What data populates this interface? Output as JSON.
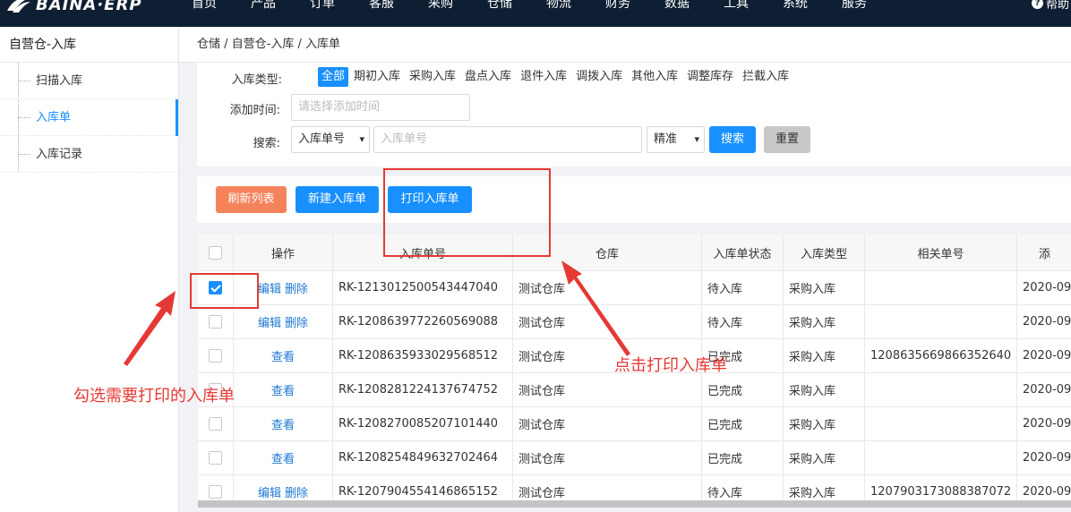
{
  "topbar": {
    "logo_text": "BAINA·ERP",
    "nav": [
      "首页",
      "产品",
      "订单",
      "客服",
      "采购",
      "仓储",
      "物流",
      "财务",
      "数据",
      "工具",
      "系统",
      "服务"
    ],
    "help_label": "帮助"
  },
  "sidebar": {
    "title": "自营仓-入库",
    "items": [
      {
        "label": "扫描入库"
      },
      {
        "label": "入库单"
      },
      {
        "label": "入库记录"
      }
    ]
  },
  "breadcrumb": "仓储 / 自营仓-入库 / 入库单",
  "filters": {
    "type_label": "入库类型:",
    "types": [
      "全部",
      "期初入库",
      "采购入库",
      "盘点入库",
      "退件入库",
      "调拨入库",
      "其他入库",
      "调整库存",
      "拦截入库"
    ],
    "selected_type": "全部",
    "time_label": "添加时间:",
    "time_placeholder": "请选择添加时间",
    "search_label": "搜索:",
    "search_field": "入库单号",
    "search_placeholder": "入库单号",
    "match_mode": "精准",
    "search_button": "搜索",
    "reset_button": "重置"
  },
  "toolbar": {
    "refresh": "刷新列表",
    "create": "新建入库单",
    "print": "打印入库单"
  },
  "table": {
    "headers": [
      "操作",
      "入库单号",
      "仓库",
      "入库单状态",
      "入库类型",
      "相关单号",
      "添"
    ],
    "rows": [
      {
        "checked": true,
        "actions": [
          "编辑",
          "删除"
        ],
        "no": "RK-1213012500543447040",
        "warehouse": "测试仓库",
        "status": "待入库",
        "type": "采购入库",
        "related": "",
        "date": "2020-09"
      },
      {
        "checked": false,
        "actions": [
          "编辑",
          "删除"
        ],
        "no": "RK-1208639772260569088",
        "warehouse": "测试仓库",
        "status": "待入库",
        "type": "采购入库",
        "related": "",
        "date": "2020-09"
      },
      {
        "checked": false,
        "actions": [
          "查看"
        ],
        "no": "RK-1208635933029568512",
        "warehouse": "测试仓库",
        "status": "已完成",
        "type": "采购入库",
        "related": "1208635669866352640",
        "date": "2020-09"
      },
      {
        "checked": false,
        "actions": [
          "查看"
        ],
        "no": "RK-1208281224137674752",
        "warehouse": "测试仓库",
        "status": "已完成",
        "type": "采购入库",
        "related": "",
        "date": "2020-09"
      },
      {
        "checked": false,
        "actions": [
          "查看"
        ],
        "no": "RK-1208270085207101440",
        "warehouse": "测试仓库",
        "status": "已完成",
        "type": "采购入库",
        "related": "",
        "date": "2020-09"
      },
      {
        "checked": false,
        "actions": [
          "查看"
        ],
        "no": "RK-1208254849632702464",
        "warehouse": "测试仓库",
        "status": "已完成",
        "type": "采购入库",
        "related": "",
        "date": "2020-09"
      },
      {
        "checked": false,
        "actions": [
          "编辑",
          "删除"
        ],
        "no": "RK-1207904554146865152",
        "warehouse": "测试仓库",
        "status": "待入库",
        "type": "采购入库",
        "related": "1207903173088387072",
        "date": "2020-09"
      }
    ]
  },
  "annotations": {
    "click_print": "点击打印入库单",
    "select_rows": "勾选需要打印的入库单"
  },
  "colors": {
    "primary": "#1890ff",
    "topbar": "#0f1f33",
    "annotation": "#e53935",
    "refresh": "#f4835b"
  }
}
